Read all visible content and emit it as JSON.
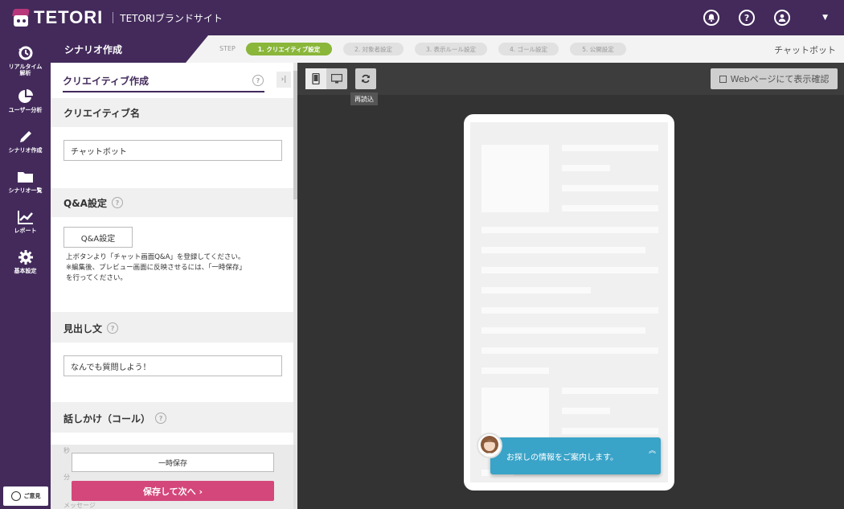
{
  "app": {
    "logo_text": "TETORI",
    "site_title": "TETORIブランドサイト"
  },
  "header_icons": [
    "bell-icon",
    "help-icon",
    "user-icon",
    "caret-down-icon"
  ],
  "sidenav": {
    "items": [
      {
        "label": "リアルタイム\n解析",
        "icon": "history-icon"
      },
      {
        "label": "ユーザー分析",
        "icon": "pie-chart-icon"
      },
      {
        "label": "シナリオ作成",
        "icon": "pencil-icon"
      },
      {
        "label": "シナリオ一覧",
        "icon": "folder-icon"
      },
      {
        "label": "レポート",
        "icon": "line-chart-icon"
      },
      {
        "label": "基本設定",
        "icon": "gear-icon"
      }
    ],
    "feedback": "ご意見"
  },
  "subheader": {
    "tab": "シナリオ作成",
    "step_label": "STEP",
    "steps": [
      "1. クリエイティブ設定",
      "2. 対象者設定",
      "3. 表示ルール設定",
      "4. ゴール設定",
      "5. 公開設定"
    ],
    "active_step": 0,
    "right_label": "チャットボット"
  },
  "panel": {
    "title": "クリエイティブ作成",
    "collapse": "›|",
    "sections": {
      "creative_name": {
        "label": "クリエイティブ名",
        "value": "チャットボット"
      },
      "qa": {
        "label": "Q&A設定",
        "button": "Q&A設定",
        "note": "上ボタンより「チャット画面Q&A」を登録してください。\n※編集後、プレビュー画面に反映させるには、「一時保存」\nを行ってください。"
      },
      "heading": {
        "label": "見出し文",
        "value": "なんでも質問しよう！"
      },
      "call": {
        "label": "話しかけ（コール）"
      }
    },
    "ghost": {
      "a": "秒",
      "b": "分",
      "c": "メッセージ"
    },
    "save_temp": "一時保存",
    "save_next": "保存して次へ ›"
  },
  "preview": {
    "reload_tooltip": "再読込",
    "web_check": "Webページにて表示確認",
    "chat_text": "お探しの情報をご案内します。",
    "chat_toggle": "︽"
  },
  "colors": {
    "brand_purple": "#432a5b",
    "step_active": "#8ab63a",
    "save_next": "#d4477a",
    "chat_bar": "#3aa3c8"
  }
}
